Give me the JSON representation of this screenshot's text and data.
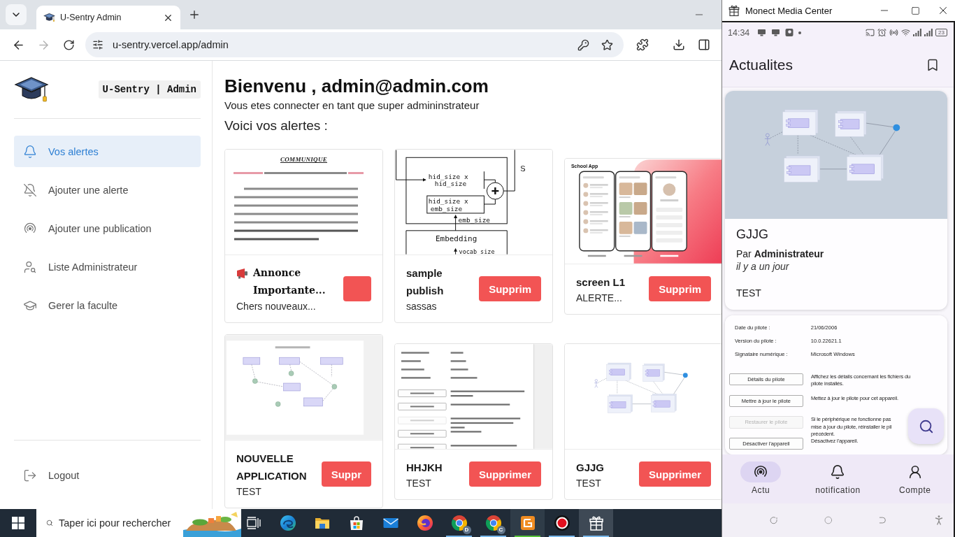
{
  "browser": {
    "tab_title": "U-Sentry Admin",
    "forward_disabled": true,
    "url": "u-sentry.vercel.app/admin"
  },
  "sidebar": {
    "brand": "U-Sentry | Admin",
    "items": [
      {
        "label": "Vos alertes",
        "selected": true
      },
      {
        "label": "Ajouter une alerte",
        "selected": false
      },
      {
        "label": "Ajouter une publication",
        "selected": false
      },
      {
        "label": "Liste Administrateur",
        "selected": false
      },
      {
        "label": "Gerer la faculte",
        "selected": false
      }
    ],
    "logout": "Logout"
  },
  "main": {
    "heading": "Bienvenu , admin@admin.com",
    "subtitle": "Vous etes connecter en tant que super admininstrateur",
    "section_title": "Voici vos alertes :",
    "alerts": [
      {
        "kind": "announcement",
        "title": "Annonce Importante...",
        "description": "Chers nouveaux...",
        "image": {
          "kind": "document",
          "heading": "COMMUNIQUE"
        }
      },
      {
        "kind": "standard",
        "title": "sample publish",
        "description": "sassas",
        "button": "Supprim",
        "image": {
          "kind": "network-diagram",
          "labels": [
            "hid_size x",
            "hid_size",
            "hid_size x",
            "emb_size",
            "emb_size",
            "Embedding",
            "vocab_size",
            "S"
          ]
        }
      },
      {
        "kind": "standard",
        "title": "screen L1",
        "description": "ALERTE...",
        "button": "Supprim",
        "image": {
          "kind": "app-mockup",
          "title": "School App"
        }
      },
      {
        "kind": "standard",
        "title": "NOUVELLE APPLICATION",
        "description": "TEST",
        "button": "Suppr",
        "image": {
          "kind": "component-diagram"
        }
      },
      {
        "kind": "standard",
        "title": "HHJKH",
        "description": "TEST",
        "button": "Supprimer",
        "image": {
          "kind": "settings-screenshot"
        }
      },
      {
        "kind": "standard",
        "title": "GJJG",
        "description": "TEST",
        "button": "Supprimer",
        "image": {
          "kind": "deployment-diagram"
        }
      }
    ]
  },
  "taskbar": {
    "search": {
      "placeholder": "Taper ici pour rechercher"
    },
    "apps": [
      {
        "running": false,
        "attention": false,
        "active": false
      },
      {
        "running": false,
        "attention": false,
        "active": false
      },
      {
        "running": false,
        "attention": false,
        "active": false
      },
      {
        "running": false,
        "attention": false,
        "active": false
      },
      {
        "running": false,
        "attention": false,
        "active": false
      },
      {
        "running": false,
        "attention": false,
        "active": false
      },
      {
        "badge": "D",
        "running": true,
        "attention": false,
        "active": false
      },
      {
        "badge": "C",
        "running": true,
        "attention": false,
        "active": false
      },
      {
        "running": true,
        "attention": true,
        "active": false
      },
      {
        "running": true,
        "attention": false,
        "active": false
      },
      {
        "running": true,
        "attention": false,
        "active": true
      }
    ]
  },
  "monect": {
    "title": "Monect Media Center",
    "phone": {
      "time": "14:34",
      "battery": "23",
      "app_title": "Actualites",
      "posts": [
        {
          "title": "GJJG",
          "byline": "Par **Administrateur**",
          "time": "il y a un jour",
          "body": "TEST",
          "image": {
            "kind": "deployment-diagram"
          }
        },
        {
          "image": {
            "kind": "driver-properties",
            "rows": [
              {
                "label": "Date du pilote :",
                "value": "21/06/2006"
              },
              {
                "label": "Version du pilote :",
                "value": "10.0.22621.1"
              },
              {
                "label": "Signataire numérique :",
                "value": "Microsoft Windows"
              }
            ],
            "actions": [
              {
                "button": "Détails du pilote",
                "disabled": false,
                "lines": [
                  "Affichez les détails concernant les fichiers du",
                  "pilote installés."
                ]
              },
              {
                "button": "Mettre à jour le pilote",
                "disabled": false,
                "lines": [
                  "Mettez à jour le pilote pour cet appareil."
                ]
              },
              {
                "button": "Restaurer le pilote",
                "disabled": true,
                "lines": [
                  "Si le périphérique ne fonctionne pas",
                  "mise à jour du pilote, réinstaller le pil",
                  "précédent."
                ]
              },
              {
                "button": "Désactiver l'appareil",
                "disabled": false,
                "lines": [
                  "Désactivez l'appareil."
                ]
              }
            ]
          }
        }
      ],
      "nav": [
        {
          "label": "Actu",
          "selected": true
        },
        {
          "label": "notification",
          "selected": false
        },
        {
          "label": "Compte",
          "selected": false
        }
      ]
    }
  }
}
